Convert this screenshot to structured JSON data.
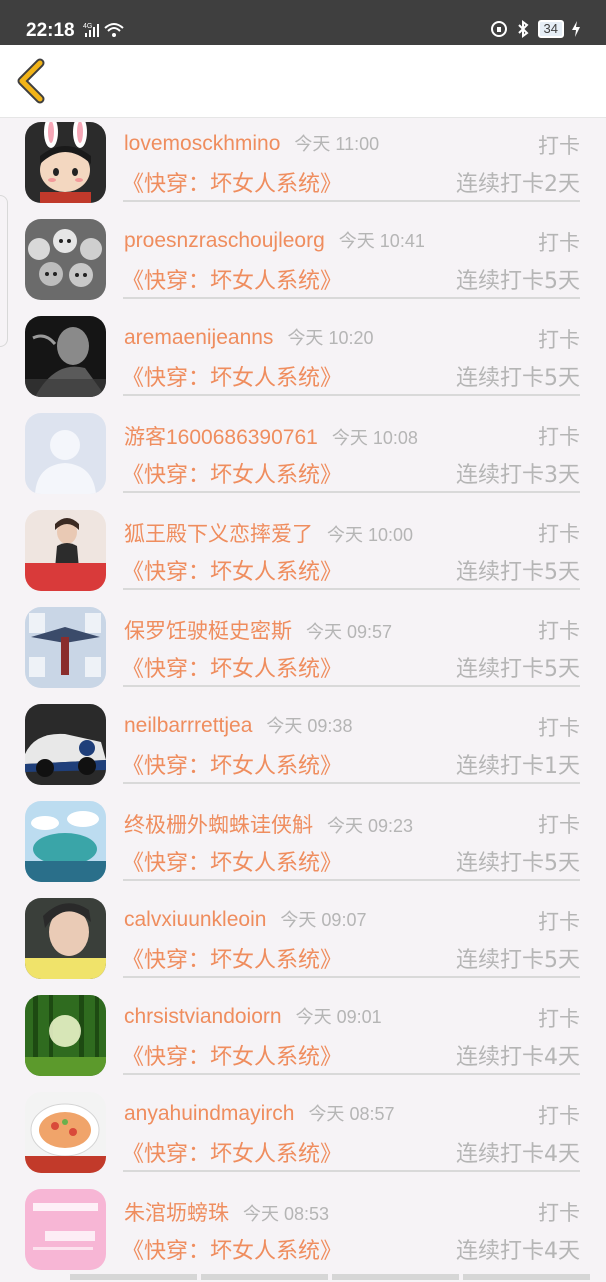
{
  "status_bar": {
    "time": "22:18",
    "network": "4G",
    "battery": "34"
  },
  "header": {
    "back_icon": "chevron-left-icon",
    "accent": "#f2b418"
  },
  "colors": {
    "name": "#ef8d5e",
    "muted": "#b5b5b5"
  },
  "items": [
    {
      "name": "lovemosckhmino",
      "time": "今天 11:00",
      "action": "打卡",
      "book": "《快穿：坏女人系统》",
      "streak": "连续打卡2天"
    },
    {
      "name": "proesnzraschoujleorg",
      "time": "今天 10:41",
      "action": "打卡",
      "book": "《快穿：坏女人系统》",
      "streak": "连续打卡5天"
    },
    {
      "name": "aremaenijeanns",
      "time": "今天 10:20",
      "action": "打卡",
      "book": "《快穿：坏女人系统》",
      "streak": "连续打卡5天"
    },
    {
      "name": "游客1600686390761",
      "time": "今天 10:08",
      "action": "打卡",
      "book": "《快穿：坏女人系统》",
      "streak": "连续打卡3天"
    },
    {
      "name": "狐王殿下义恋摔爱了",
      "time": "今天 10:00",
      "action": "打卡",
      "book": "《快穿：坏女人系统》",
      "streak": "连续打卡5天"
    },
    {
      "name": "保罗饪驶梃史密斯",
      "time": "今天 09:57",
      "action": "打卡",
      "book": "《快穿：坏女人系统》",
      "streak": "连续打卡5天"
    },
    {
      "name": "neilbarrrettjea",
      "time": "今天 09:38",
      "action": "打卡",
      "book": "《快穿：坏女人系统》",
      "streak": "连续打卡1天"
    },
    {
      "name": "终极栅外蜘蛛诖侠斛",
      "time": "今天 09:23",
      "action": "打卡",
      "book": "《快穿：坏女人系统》",
      "streak": "连续打卡5天"
    },
    {
      "name": "calvxiuunkleoin",
      "time": "今天 09:07",
      "action": "打卡",
      "book": "《快穿：坏女人系统》",
      "streak": "连续打卡5天"
    },
    {
      "name": "chrsistviandoiorn",
      "time": "今天 09:01",
      "action": "打卡",
      "book": "《快穿：坏女人系统》",
      "streak": "连续打卡4天"
    },
    {
      "name": "anyahuindmayirch",
      "time": "今天 08:57",
      "action": "打卡",
      "book": "《快穿：坏女人系统》",
      "streak": "连续打卡4天"
    },
    {
      "name": "朱涫坜螃珠",
      "time": "今天 08:53",
      "action": "打卡",
      "book": "《快穿：坏女人系统》",
      "streak": "连续打卡4天"
    }
  ]
}
